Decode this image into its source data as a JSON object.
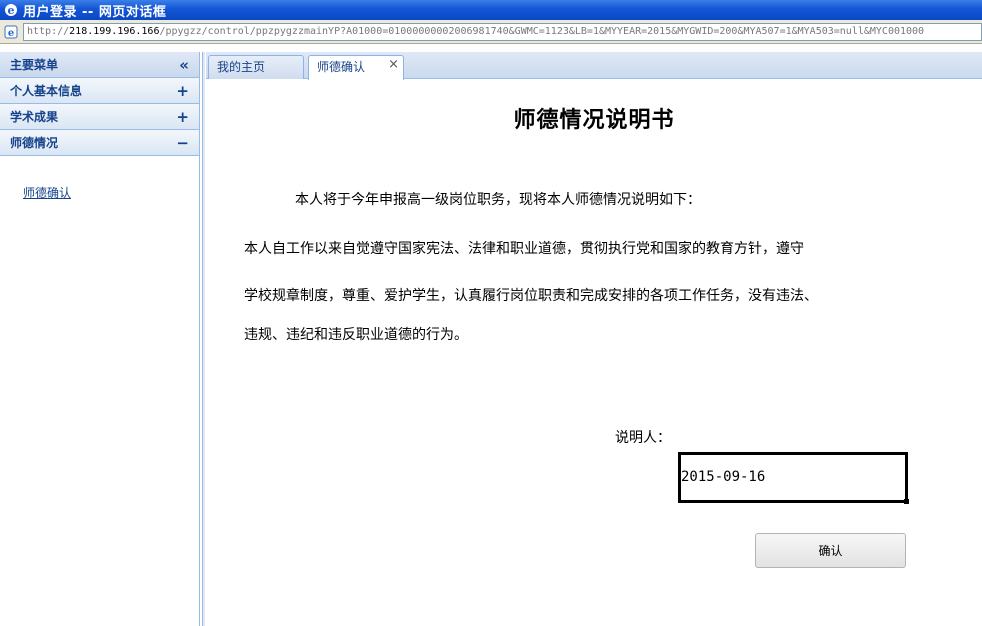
{
  "window": {
    "title": "用户登录 -- 网页对话框"
  },
  "address": {
    "scheme": "http://",
    "host": "218.199.196.166",
    "path": "/ppygzz/control/ppzpygzzmainYP?A01000=01000000002006981740&GWMC=1123&LB=1&MYYEAR=2015&MYGWID=200&MYA507=1&MYA503=null&MYC001000"
  },
  "sidebar": {
    "header": "主要菜单",
    "header_symbol": "«",
    "items": [
      {
        "label": "个人基本信息",
        "symbol": "+"
      },
      {
        "label": "学术成果",
        "symbol": "+"
      },
      {
        "label": "师德情况",
        "symbol": "−"
      }
    ],
    "sublink": "师德确认"
  },
  "tabs": [
    {
      "label": "我的主页"
    },
    {
      "label": "师德确认",
      "close": "×"
    }
  ],
  "document": {
    "title": "师德情况说明书",
    "para1": "本人将于今年申报高一级岗位职务，现将本人师德情况说明如下：",
    "para2": "本人自工作以来自觉遵守国家宪法、法律和职业道德，贯彻执行党和国家的教育方针，遵守",
    "para3": "学校规章制度，尊重、爱护学生，认真履行岗位职责和完成安排的各项工作任务，没有违法、",
    "para4": "违规、违纪和违反职业道德的行为。",
    "sign_label": "说明人：",
    "date_value": "2015-09-16",
    "confirm_label": "确认"
  },
  "colors": {
    "titlebar": "#1356d6",
    "panel_border": "#99bbe8",
    "header_text": "#15428b"
  }
}
